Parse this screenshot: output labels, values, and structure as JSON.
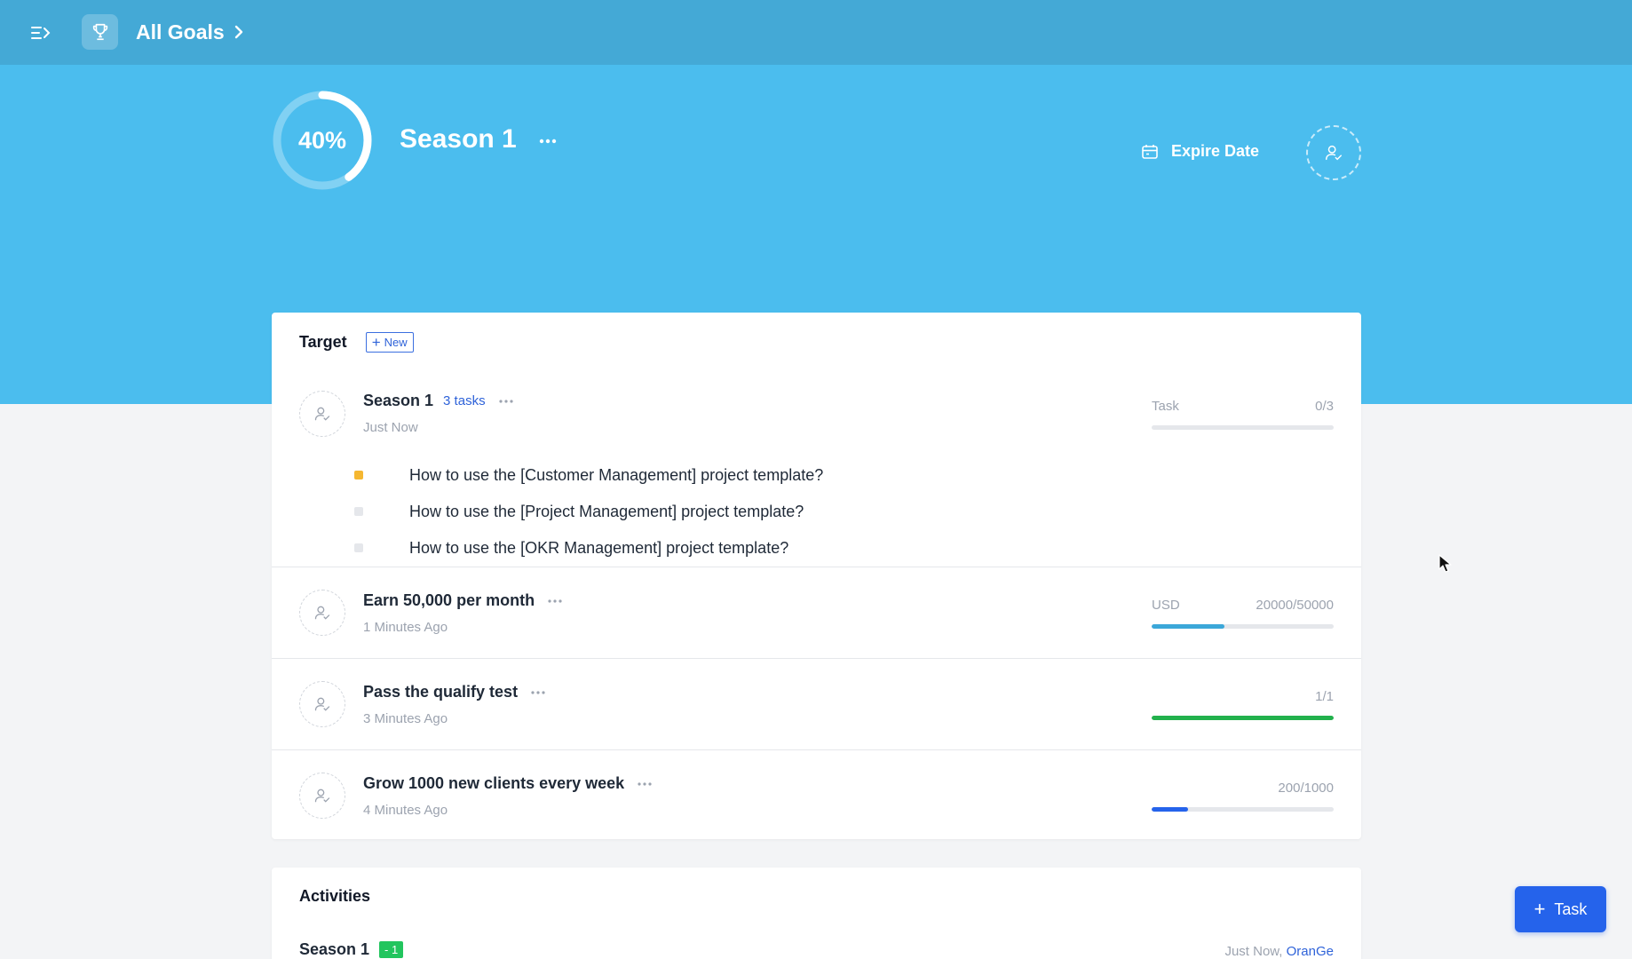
{
  "header": {
    "breadcrumb": "All Goals"
  },
  "goal": {
    "progress_text": "40%",
    "progress": 0.4,
    "title": "Season 1",
    "expire_label": "Expire Date"
  },
  "target": {
    "title": "Target",
    "new_label": "New",
    "rows": [
      {
        "name": "Season 1",
        "tasks_link": "3 tasks",
        "time": "Just Now",
        "metric_label": "Task",
        "metric_value": "0/3",
        "progress": 0,
        "bar_color": "#9ca3af",
        "tasks": [
          {
            "text": "How to use the [Customer Management] project template?",
            "color": "#f5b731"
          },
          {
            "text": "How to use the [Project Management] project template?",
            "color": "#e5e7eb"
          },
          {
            "text": "How to use the [OKR Management] project template?",
            "color": "#e5e7eb"
          }
        ]
      },
      {
        "name": "Earn 50,000 per month",
        "time": "1 Minutes Ago",
        "metric_label": "USD",
        "metric_value": "20000/50000",
        "progress": 0.4,
        "bar_color": "#3ba7d9"
      },
      {
        "name": "Pass the qualify test",
        "time": "3 Minutes Ago",
        "metric_label": "",
        "metric_value": "1/1",
        "progress": 1.0,
        "bar_color": "#22b14c"
      },
      {
        "name": "Grow 1000 new clients every week",
        "time": "4 Minutes Ago",
        "metric_label": "",
        "metric_value": "200/1000",
        "progress": 0.2,
        "bar_color": "#2563eb"
      }
    ]
  },
  "activities": {
    "title": "Activities",
    "items": [
      {
        "name": "Season 1",
        "badge": "- 1",
        "time": "Just Now,",
        "user": "OranGe"
      }
    ]
  },
  "fab": {
    "label": "Task"
  },
  "colors": {
    "topbar": "#44a9d6",
    "hero": "#4bbdee",
    "accent": "#2563eb"
  }
}
